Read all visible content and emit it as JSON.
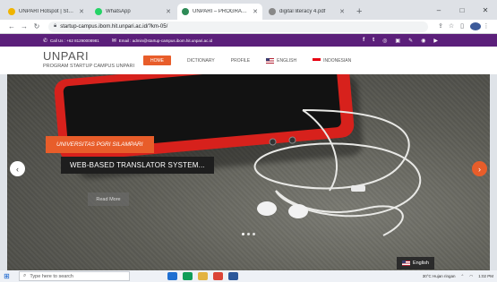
{
  "browser": {
    "tabs": [
      {
        "title": "UNPARI Hotspot | Status",
        "favicon_color": "#f0b400",
        "active": false
      },
      {
        "title": "WhatsApp",
        "favicon_color": "#25d366",
        "active": false
      },
      {
        "title": "UNPARI – PROGRAM STARTUP",
        "favicon_color": "#2e8b57",
        "active": true
      },
      {
        "title": "digital literacy 4.pdf",
        "favicon_color": "#888888",
        "active": false
      }
    ],
    "new_tab": "+",
    "url": "startup-campus.ibom.hit.unpari.ac.id/?km-05/",
    "window_controls": [
      "–",
      "□",
      "✕"
    ]
  },
  "topbar": {
    "phone": "Call Us : +62 81290008981",
    "email": "Email : admin@startup-campus.ibom.hit.unpari.ac.id",
    "social": [
      "f",
      "t",
      "◎",
      "▣",
      "✎",
      "◉",
      "▶"
    ]
  },
  "site": {
    "logo_name": "UNPARI",
    "logo_sub": "PROGRAM STARTUP CAMPUS UNPARI",
    "menu": [
      {
        "label": "HOME",
        "active": true
      },
      {
        "label": "DICTIONARY",
        "active": false
      },
      {
        "label": "PROFILE",
        "active": false
      },
      {
        "label": "ENGLISH",
        "flag": "en",
        "active": false
      },
      {
        "label": "INDONESIAN",
        "flag": "id",
        "active": false
      }
    ]
  },
  "hero": {
    "caption_top": "UNIVERSITAS PGRI SILAMPARI",
    "caption_main": "WEB-BASED TRANSLATOR SYSTEM...",
    "read_more": "Read More",
    "prev": "‹",
    "next": "›",
    "language": "English",
    "accent": "#e85d2a"
  },
  "taskbar": {
    "search_placeholder": "Type here to search",
    "weather": "30°C Hujan ringan",
    "time": "1:02 PM"
  }
}
